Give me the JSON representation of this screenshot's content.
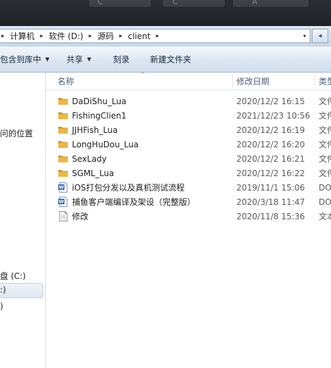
{
  "titlebar": {
    "fragments": [
      "C",
      "C",
      "A"
    ]
  },
  "address": {
    "crumbs": [
      "计算机",
      "软件 (D:)",
      "源码",
      "client"
    ],
    "sep": "▸",
    "leading_sep": "▸",
    "dropdown_glyph": "▾",
    "refresh_glyph": "◂"
  },
  "toolbar": {
    "include_in_library": "包含到库中",
    "share": "共享",
    "burn": "刻录",
    "new_folder": "新建文件夹",
    "arrow": "▼"
  },
  "navpane": {
    "item_location": "问的位置",
    "item_drive_c": "盘 (C:)",
    "item_sel": ":)",
    "item_last": ")"
  },
  "columns": {
    "name": "名称",
    "date": "修改日期",
    "type": "类型",
    "sort_glyph": "^"
  },
  "files": [
    {
      "name": "DaDiShu_Lua",
      "date": "2020/12/2 16:15",
      "type": "文件",
      "icon": "folder-icon"
    },
    {
      "name": "FishingClien1",
      "date": "2021/12/23 10:56",
      "type": "文件",
      "icon": "folder-icon"
    },
    {
      "name": "JJHFish_Lua",
      "date": "2020/12/2 16:19",
      "type": "文件",
      "icon": "folder-icon"
    },
    {
      "name": "LongHuDou_Lua",
      "date": "2020/12/2 16:20",
      "type": "文件",
      "icon": "folder-icon"
    },
    {
      "name": "SexLady",
      "date": "2020/12/2 16:21",
      "type": "文件",
      "icon": "folder-icon"
    },
    {
      "name": "SGML_Lua",
      "date": "2020/12/2 16:22",
      "type": "文件",
      "icon": "folder-icon"
    },
    {
      "name": "iOS打包分发以及真机测试流程",
      "date": "2019/11/1 15:06",
      "type": "DO",
      "icon": "word-doc-icon"
    },
    {
      "name": "捕鱼客户端编译及架设（完整版）",
      "date": "2020/3/18 11:47",
      "type": "DO",
      "icon": "word-doc-icon"
    },
    {
      "name": "修改",
      "date": "2020/11/8 15:36",
      "type": "文本",
      "icon": "text-file-icon"
    }
  ],
  "colors": {
    "folder": "#e8b94a",
    "folder_dark": "#c9952b",
    "word": "#2b5fb4",
    "accent": "#1c4f8a"
  }
}
